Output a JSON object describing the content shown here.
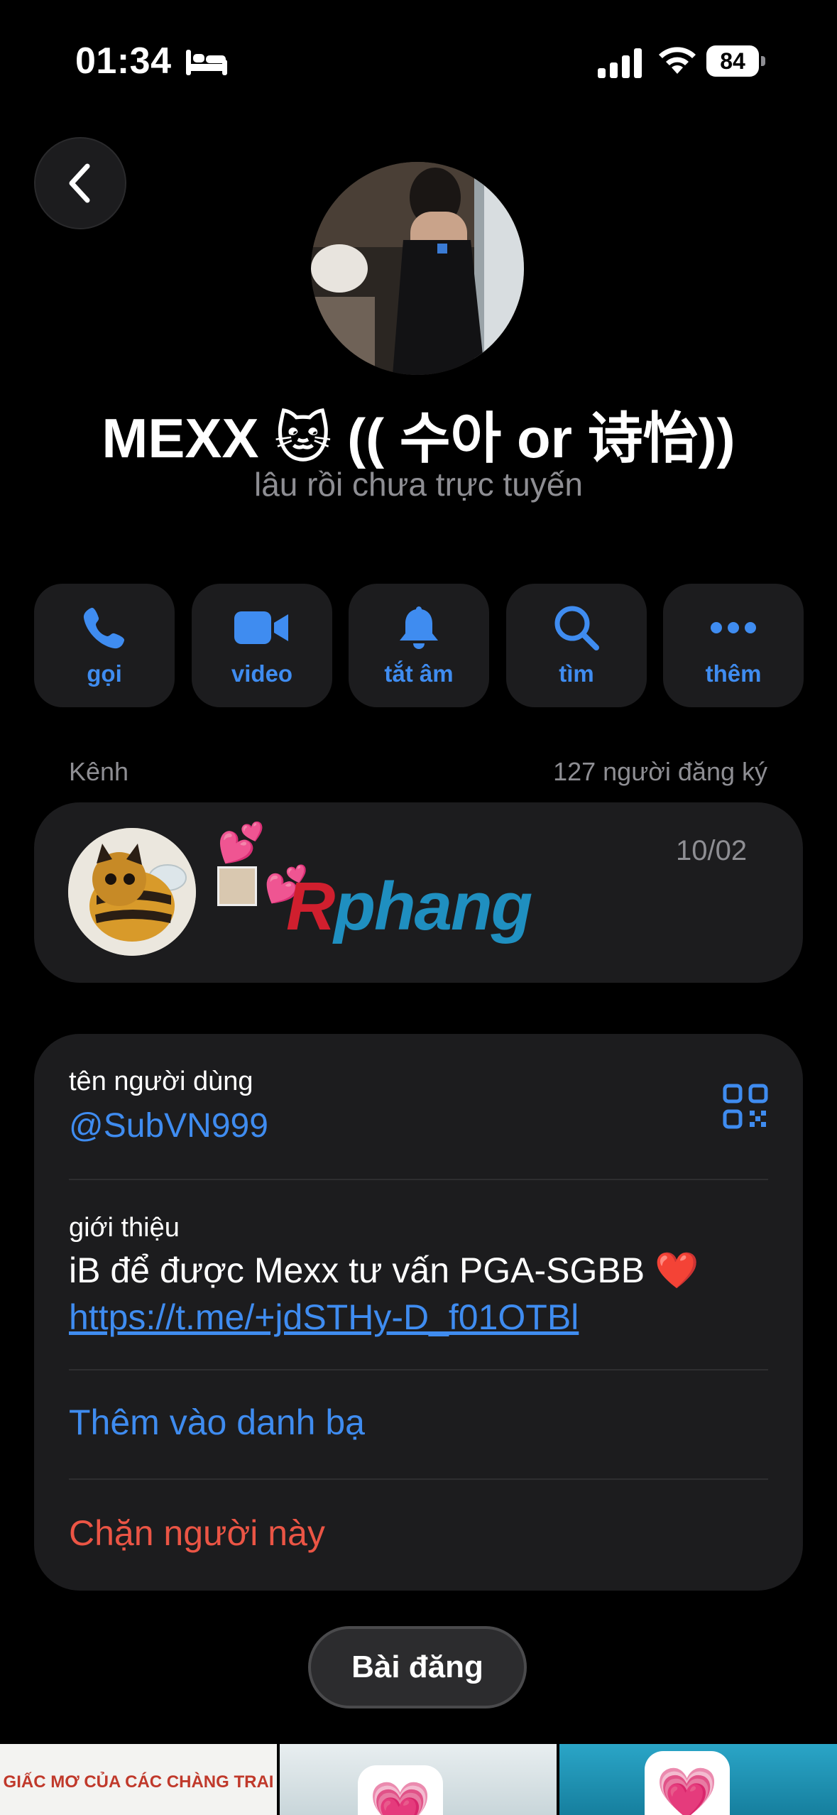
{
  "status_bar": {
    "time": "01:34",
    "battery": "84"
  },
  "profile": {
    "name": "MEXX 🐱 (( 수아 or 诗怡))",
    "presence": "lâu rồi chưa trực tuyến"
  },
  "actions": [
    {
      "label": "gọi",
      "icon": "phone-icon"
    },
    {
      "label": "video",
      "icon": "video-camera-icon"
    },
    {
      "label": "tắt âm",
      "icon": "bell-icon"
    },
    {
      "label": "tìm",
      "icon": "search-icon"
    },
    {
      "label": "thêm",
      "icon": "more-icon"
    }
  ],
  "channel": {
    "section_label": "Kênh",
    "subscribers": "127 người đăng ký",
    "name_emoji": "💕",
    "name_r": "R",
    "name_rest": "phang",
    "date": "10/02"
  },
  "info": {
    "username_label": "tên người dùng",
    "username": "@SubVN999",
    "bio_label": "giới thiệu",
    "bio": "iB để được Mexx tư vấn PGA-SGBB ❤️",
    "bio_link": "https://t.me/+jdSTHy-D_f01OTBl",
    "add_contact": "Thêm vào danh bạ",
    "block": "Chặn người này"
  },
  "posts_button": "Bài đăng",
  "thumbnails": [
    {
      "caption": "GIẤC MƠ CỦA CÁC CHÀNG TRAI"
    },
    {
      "caption": ""
    },
    {
      "caption": ""
    }
  ],
  "colors": {
    "accent": "#3f8cf0",
    "danger": "#eb5545",
    "card": "#1c1c1e"
  }
}
